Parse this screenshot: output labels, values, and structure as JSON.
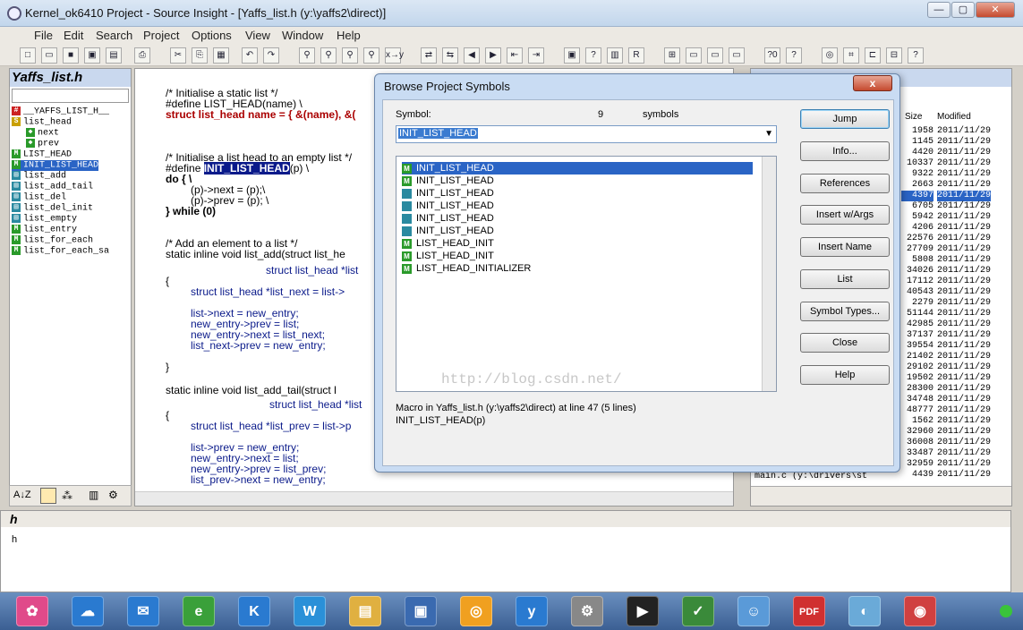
{
  "window": {
    "title": "Kernel_ok6410 Project - Source Insight - [Yaffs_list.h (y:\\yaffs2\\direct)]",
    "controls": [
      "—",
      "▢",
      "✕"
    ]
  },
  "menu": [
    "File",
    "Edit",
    "Search",
    "Project",
    "Options",
    "View",
    "Window",
    "Help"
  ],
  "left_panel": {
    "title": "Yaffs_list.h",
    "items": [
      {
        "label": "__YAFFS_LIST_H__",
        "icon": "#"
      },
      {
        "label": "list_head",
        "icon": "S"
      },
      {
        "label": "next",
        "icon": "◆"
      },
      {
        "label": "prev",
        "icon": "◆"
      },
      {
        "label": "LIST_HEAD",
        "icon": "M"
      },
      {
        "label": "INIT_LIST_HEAD",
        "icon": "M",
        "selected": true
      },
      {
        "label": "list_add",
        "icon": "▤"
      },
      {
        "label": "list_add_tail",
        "icon": "▤"
      },
      {
        "label": "list_del",
        "icon": "▤"
      },
      {
        "label": "list_del_init",
        "icon": "▤"
      },
      {
        "label": "list_empty",
        "icon": "▤"
      },
      {
        "label": "list_entry",
        "icon": "M"
      },
      {
        "label": "list_for_each",
        "icon": "M"
      },
      {
        "label": "list_for_each_sa",
        "icon": "M"
      }
    ]
  },
  "editor": {
    "lines": [
      "/* Initialise a static list */",
      "#define LIST_HEAD(name) \\",
      "struct list_head name = { &(name), &(",
      "/* Initialise a list head to an empty list */",
      "#define INIT_LIST_HEAD(p) \\",
      "do { \\",
      "(p)->next = (p);\\",
      "(p)->prev = (p); \\",
      "} while (0)",
      "/* Add an element to a list */",
      "static inline void list_add(struct list_he",
      "struct list_head *list",
      "{",
      "struct list_head *list_next = list->",
      "list->next = new_entry;",
      "new_entry->prev = list;",
      "new_entry->next = list_next;",
      "list_next->prev = new_entry;",
      "}",
      "static inline void list_add_tail(struct l",
      "struct list_head *list",
      "{",
      "struct list_head *list_prev = list->p",
      "list->prev = new_entry;",
      "new_entry->next = list;",
      "new_entry->prev = list_prev;",
      "list_prev->next = new_entry;"
    ]
  },
  "right_panel": {
    "title": "Kernel_ok6410 Project",
    "columns": [
      "Size",
      "Modified"
    ],
    "rows": [
      [
        "1958",
        "2011/11/29"
      ],
      [
        "1145",
        "2011/11/29"
      ],
      [
        "4420",
        "2011/11/29"
      ],
      [
        "10337",
        "2011/11/29"
      ],
      [
        "9322",
        "2011/11/29"
      ],
      [
        "2663",
        "2011/11/29"
      ],
      [
        "4397",
        "2011/11/29"
      ],
      [
        "6705",
        "2011/11/29"
      ],
      [
        "5942",
        "2011/11/29"
      ],
      [
        "4206",
        "2011/11/29"
      ],
      [
        "22576",
        "2011/11/29"
      ],
      [
        "27709",
        "2011/11/29"
      ],
      [
        "5808",
        "2011/11/29"
      ],
      [
        "34026",
        "2011/11/29"
      ],
      [
        "17112",
        "2011/11/29"
      ],
      [
        "40543",
        "2011/11/29"
      ],
      [
        "2279",
        "2011/11/29"
      ],
      [
        "51144",
        "2011/11/29"
      ],
      [
        "42985",
        "2011/11/29"
      ],
      [
        "37137",
        "2011/11/29"
      ],
      [
        "39554",
        "2011/11/29"
      ],
      [
        "21402",
        "2011/11/29"
      ],
      [
        "29102",
        "2011/11/29"
      ],
      [
        "19502",
        "2011/11/29"
      ],
      [
        "28300",
        "2011/11/29"
      ],
      [
        "34748",
        "2011/11/29"
      ],
      [
        "48777",
        "2011/11/29"
      ],
      [
        "1562",
        "2011/11/29"
      ],
      [
        "32960",
        "2011/11/29"
      ],
      [
        "36008",
        "2011/11/29"
      ],
      [
        "33487",
        "2011/11/29"
      ],
      [
        "32959",
        "2011/11/29"
      ],
      [
        "4439",
        "2011/11/29"
      ]
    ],
    "last_file": "main.c (y:\\drivers\\st"
  },
  "bottom_panel": {
    "title": "h",
    "content": "h"
  },
  "dialog": {
    "title": "Browse Project Symbols",
    "close_label": "x",
    "symbol_label": "Symbol:",
    "count": "9",
    "count_label": "symbols",
    "input_value": "INIT_LIST_HEAD",
    "symbols": [
      {
        "label": "INIT_LIST_HEAD",
        "kind": "macro",
        "selected": true
      },
      {
        "label": "INIT_LIST_HEAD",
        "kind": "macro"
      },
      {
        "label": "INIT_LIST_HEAD",
        "kind": "file"
      },
      {
        "label": "INIT_LIST_HEAD",
        "kind": "file"
      },
      {
        "label": "INIT_LIST_HEAD",
        "kind": "file"
      },
      {
        "label": "INIT_LIST_HEAD",
        "kind": "file"
      },
      {
        "label": "LIST_HEAD_INIT",
        "kind": "macro"
      },
      {
        "label": "LIST_HEAD_INIT",
        "kind": "macro"
      },
      {
        "label": "LIST_HEAD_INITIALIZER",
        "kind": "macro"
      }
    ],
    "buttons": [
      "Jump",
      "Info...",
      "References",
      "Insert w/Args",
      "Insert Name",
      "List",
      "Symbol Types...",
      "Close",
      "Help"
    ],
    "info_line1": "Macro in Yaffs_list.h (y:\\yaffs2\\direct) at line 47 (5 lines)",
    "info_line2": "INIT_LIST_HEAD(p)",
    "watermark": "http://blog.csdn.net/"
  },
  "taskbar": {
    "apps": [
      "✿",
      "☁",
      "✉",
      "e",
      "K",
      "W",
      "▤",
      "▣",
      "◎",
      "y",
      "⚙",
      "▶",
      "✓",
      "☺",
      "PDF",
      "◐",
      "◉"
    ]
  },
  "colors": {
    "selection": "#2a64c5",
    "dialog_bg": "#c9dcf3",
    "accent": "#3b7bd0"
  }
}
